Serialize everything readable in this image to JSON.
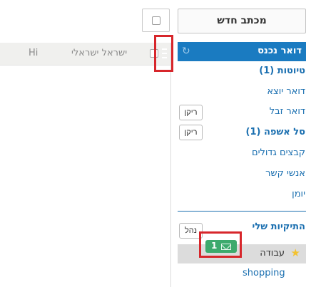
{
  "compose": {
    "label": "מכתב חדש"
  },
  "inbox": {
    "label": "דואר נכנס"
  },
  "folders": {
    "drafts": "טיוטות (1)",
    "sent": "דואר יוצא",
    "spam": "דואר זבל",
    "spam_empty": "ריקן",
    "trash": "סל אשפה (1)",
    "trash_empty": "ריקן",
    "large_files": "קבצים גדולים",
    "contacts": "אנשי קשר",
    "calendar": "יומן"
  },
  "my_folders": {
    "title": "התיקיות שלי",
    "manage": "נהל",
    "items": [
      {
        "label": "עבודה",
        "unread": "1",
        "starred": true
      },
      {
        "label": "shopping"
      }
    ]
  },
  "message_list": {
    "rows": [
      {
        "sender": "ישראל ישראלי",
        "subject": "Hi"
      }
    ]
  },
  "colors": {
    "accent": "#1a7bc1",
    "link": "#1a6fb0",
    "badge": "#3daa6d",
    "highlight": "#d7262b"
  },
  "icons": {
    "refresh": "refresh-icon",
    "star": "star-icon",
    "envelope": "envelope-icon",
    "drag": "drag-handle-icon"
  }
}
